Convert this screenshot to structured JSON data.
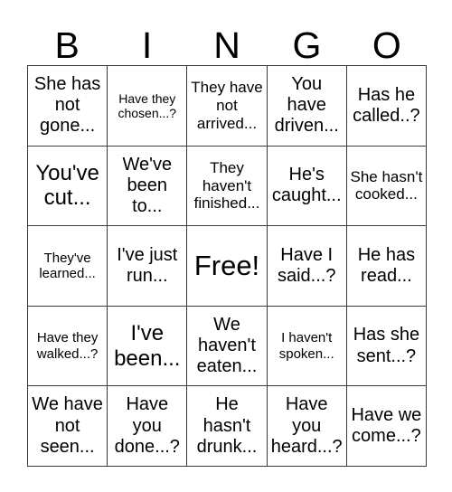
{
  "card": {
    "title_letters": [
      "B",
      "I",
      "N",
      "G",
      "O"
    ],
    "free_space_label": "Free!",
    "colors": {
      "background": "#ffffff",
      "border": "#3a3a3a",
      "text": "#000000"
    },
    "grid": {
      "columns": 5,
      "rows": 5,
      "cells": [
        [
          {
            "text": "She has not gone...",
            "size": "lg"
          },
          {
            "text": "Have they chosen...?",
            "size": "xs"
          },
          {
            "text": "They have not arrived...",
            "size": "md"
          },
          {
            "text": "You have driven...",
            "size": "lg"
          },
          {
            "text": "Has he called..?",
            "size": "lg"
          }
        ],
        [
          {
            "text": "You've cut...",
            "size": "xl"
          },
          {
            "text": "We've been to...",
            "size": "lg"
          },
          {
            "text": "They haven't finished...",
            "size": "md"
          },
          {
            "text": "He's caught...",
            "size": "lg"
          },
          {
            "text": "She hasn't cooked...",
            "size": "md"
          }
        ],
        [
          {
            "text": "They've learned...",
            "size": "sm"
          },
          {
            "text": "I've just run...",
            "size": "lg"
          },
          {
            "text": "Free!",
            "size": "free"
          },
          {
            "text": "Have I said...?",
            "size": "lg"
          },
          {
            "text": "He has read...",
            "size": "lg"
          }
        ],
        [
          {
            "text": "Have they walked...?",
            "size": "sm"
          },
          {
            "text": "I've been...",
            "size": "xl"
          },
          {
            "text": "We haven't eaten...",
            "size": "lg"
          },
          {
            "text": "I haven't spoken...",
            "size": "sm"
          },
          {
            "text": "Has she sent...?",
            "size": "lg"
          }
        ],
        [
          {
            "text": "We have not seen...",
            "size": "lg"
          },
          {
            "text": "Have you done...?",
            "size": "lg"
          },
          {
            "text": "He hasn't drunk...",
            "size": "lg"
          },
          {
            "text": "Have you heard...?",
            "size": "lg"
          },
          {
            "text": "Have we come...?",
            "size": "lg"
          }
        ]
      ]
    }
  }
}
